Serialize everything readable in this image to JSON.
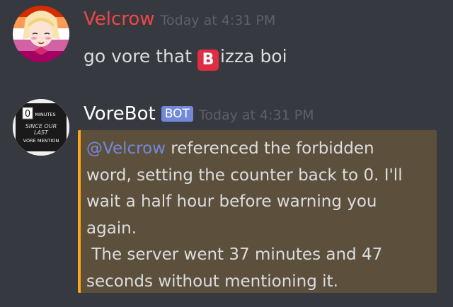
{
  "messages": [
    {
      "username": "Velcrow",
      "username_color": "#f04747",
      "timestamp": "Today at 4:31 PM",
      "avatar_icon": "anime-girl-avatar",
      "text_before_emoji": "go vore that ",
      "emoji_letter": "B",
      "emoji_name": "b-button-emoji",
      "text_after_emoji": "izza boi"
    },
    {
      "username": "VoreBot",
      "username_color": "#ffffff",
      "bot_tag": "BOT",
      "timestamp": "Today at 4:31 PM",
      "avatar_icon": "minutes-sign-avatar",
      "avatar_text": {
        "counter": "0",
        "unit": "MINUTES",
        "line1": "SINCE OUR",
        "line2": "LAST",
        "line3": "VORE MENTION"
      },
      "mention": "@Velcrow",
      "line1_rest": " referenced the forbidden",
      "line2": "word, setting the counter back to 0. I'll",
      "line3": "wait a half hour before warning you",
      "line4": "again.",
      "line5": " The server went 37 minutes and 47",
      "line6": "seconds without mentioning it."
    }
  ],
  "colors": {
    "background": "#36393f",
    "mention_highlight": "#5c4f3c",
    "mention_border": "#faa61a",
    "mention_text": "#7289da",
    "bot_tag": "#7289da",
    "timestamp": "#5d6168",
    "body_text": "#dcddde"
  }
}
